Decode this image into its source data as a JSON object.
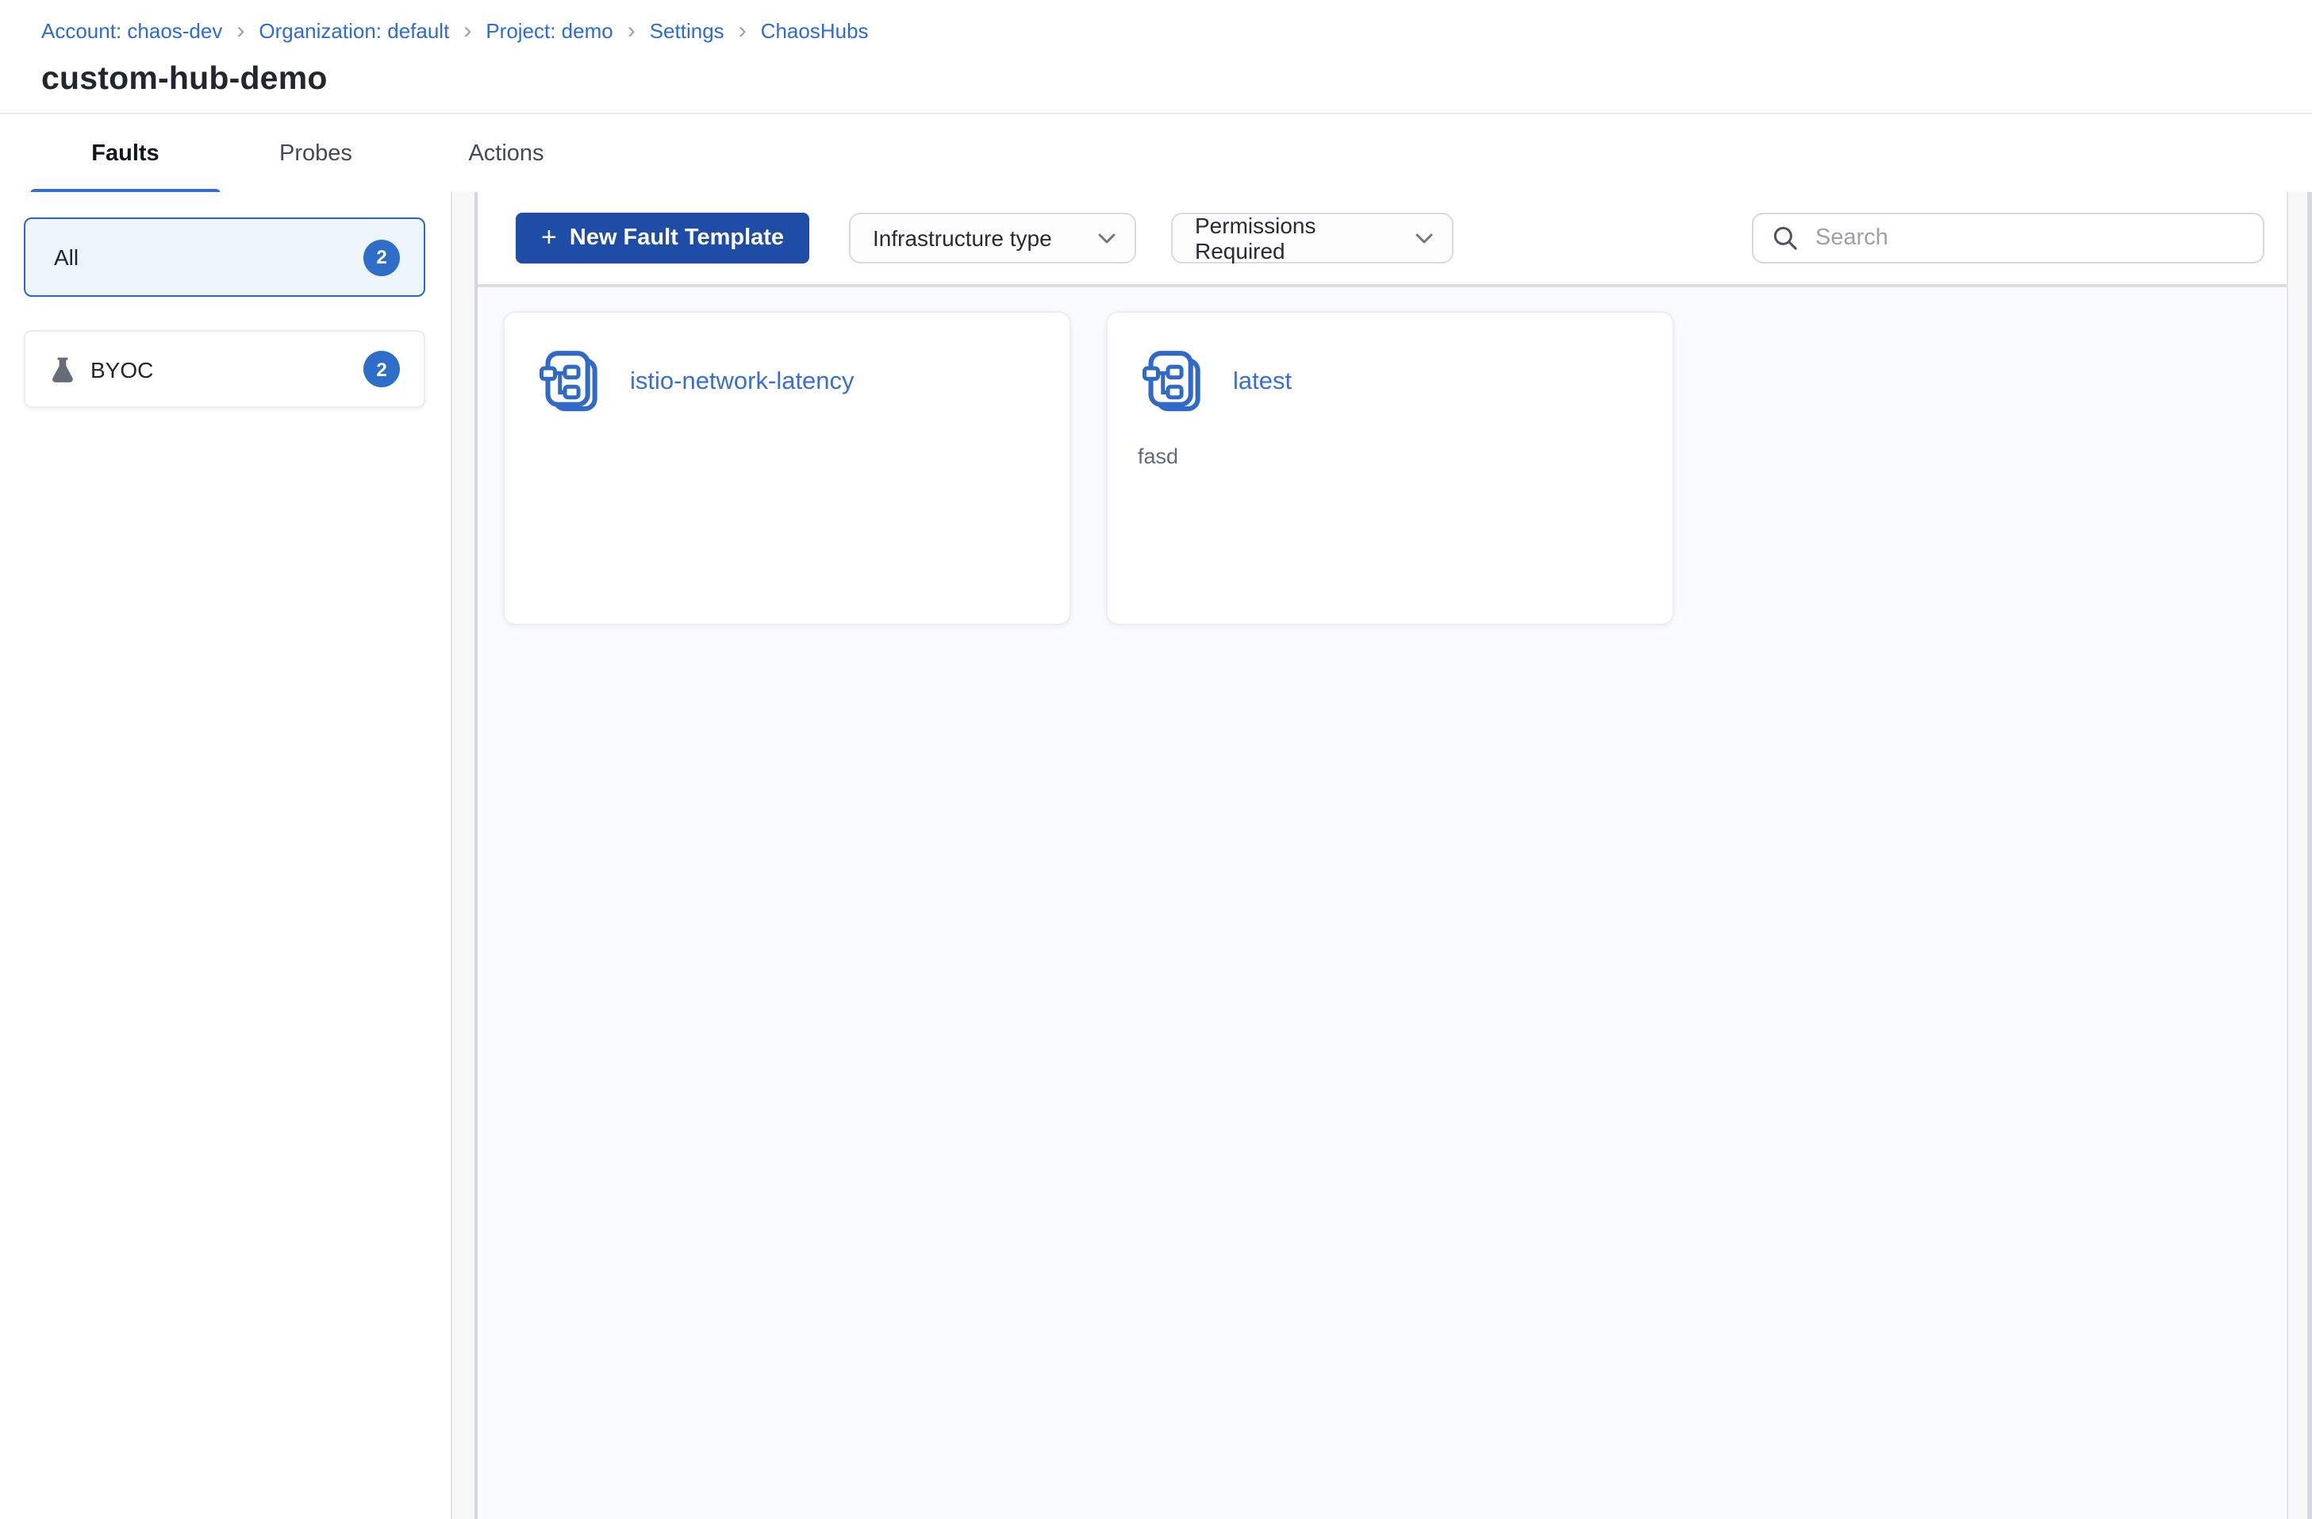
{
  "breadcrumb": {
    "separator": "›",
    "items": [
      {
        "label": "Account: chaos-dev"
      },
      {
        "label": "Organization: default"
      },
      {
        "label": "Project: demo"
      },
      {
        "label": "Settings"
      },
      {
        "label": "ChaosHubs"
      }
    ]
  },
  "page": {
    "title": "custom-hub-demo"
  },
  "tabs": [
    {
      "label": "Faults",
      "active": true
    },
    {
      "label": "Probes",
      "active": false
    },
    {
      "label": "Actions",
      "active": false
    }
  ],
  "sidebar": {
    "filters": [
      {
        "label": "All",
        "count": "2",
        "selected": true
      },
      {
        "label": "BYOC",
        "count": "2",
        "icon": "flask-icon",
        "selected": false
      }
    ]
  },
  "toolbar": {
    "new_template_button": {
      "plus": "+",
      "label": "New Fault Template",
      "icon": "plus-icon"
    },
    "filters": [
      {
        "label": "Infrastructure type",
        "icon": "chevron-down-icon"
      },
      {
        "label": "Permissions Required",
        "icon": "chevron-down-icon"
      }
    ],
    "search": {
      "placeholder": "Search",
      "value": "",
      "icon": "search-icon"
    }
  },
  "cards": [
    {
      "title": "istio-network-latency",
      "description": "",
      "icon": "fault-template-stack-icon"
    },
    {
      "title": "latest",
      "description": "fasd",
      "icon": "fault-template-stack-icon"
    }
  ],
  "colors": {
    "primary_button": "#1e4ca6",
    "link_blue": "#2e6bd2",
    "badge_blue": "#2e6ec9",
    "selected_bg": "#eef6fc",
    "selected_border": "#2b66c6",
    "tab_underline": "#3671c9",
    "card_title_blue": "#3a6ed2",
    "content_bg": "#fafbfe",
    "flask_gray": "#666d79"
  }
}
